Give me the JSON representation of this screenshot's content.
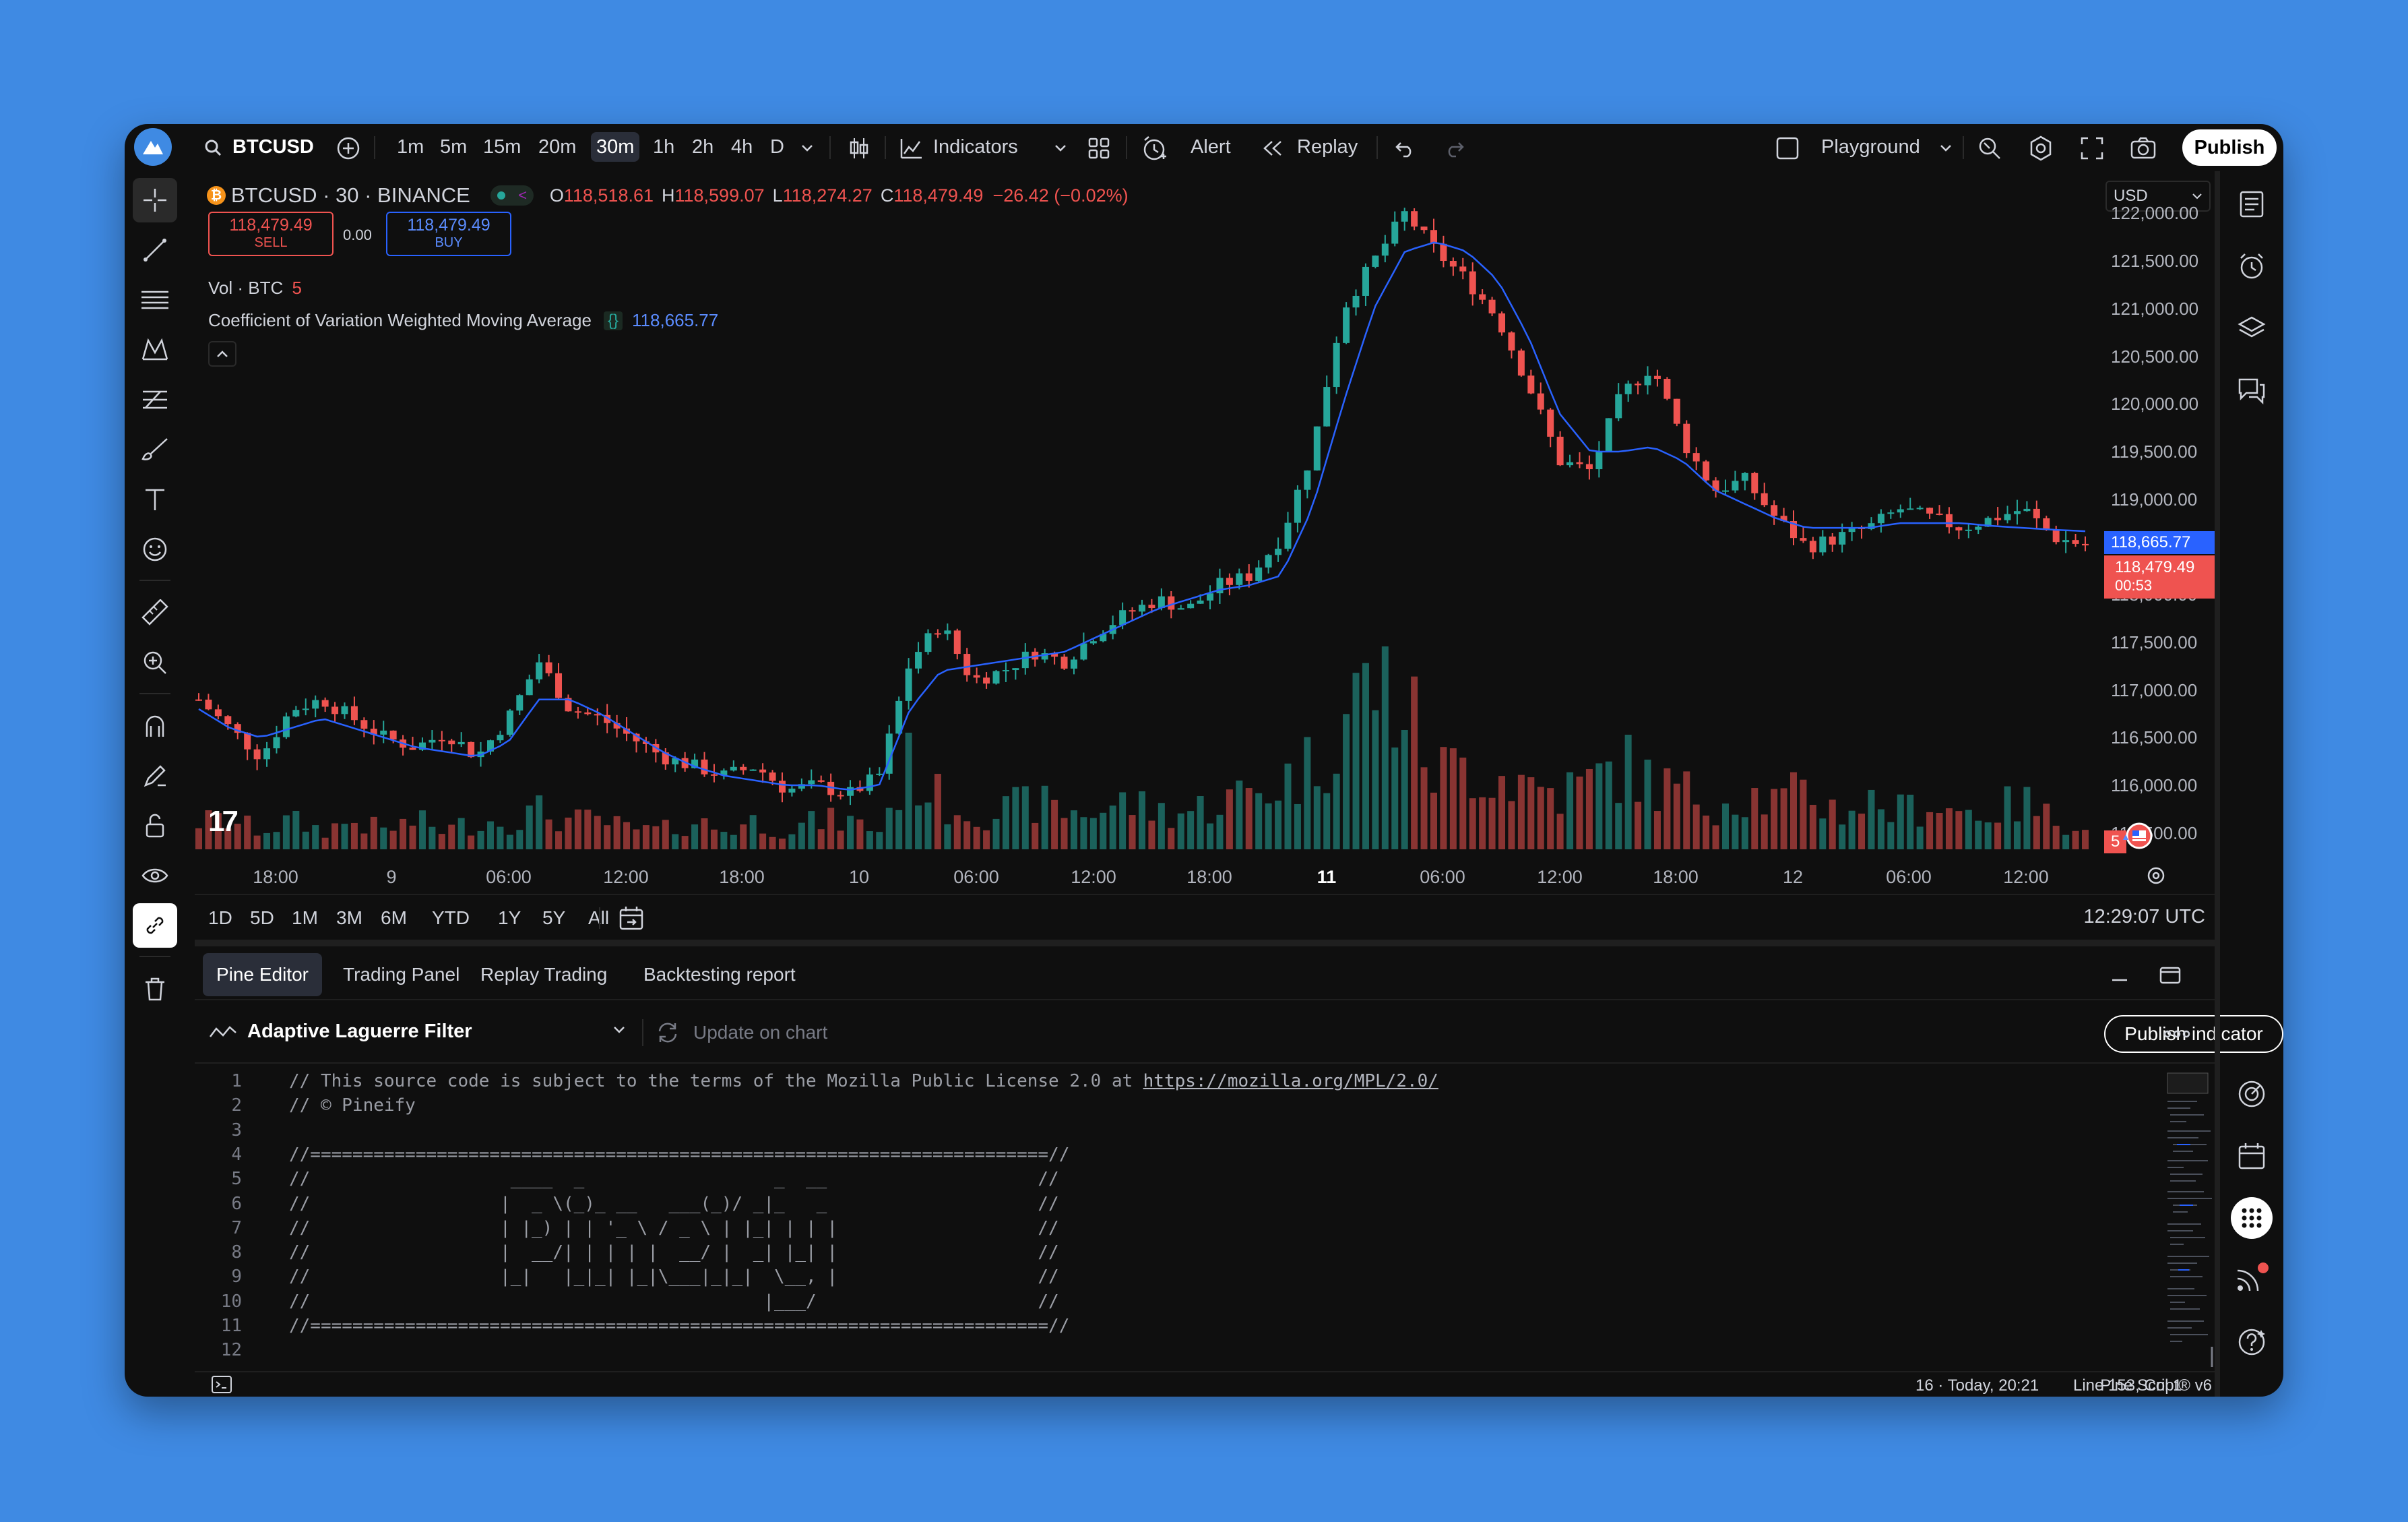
{
  "colors": {
    "up": "#26a69a",
    "down": "#ef5350",
    "ma": "#2962ff",
    "bg": "#0f0f0f",
    "accent": "#3f8ae3"
  },
  "topbar": {
    "symbol": "BTCUSD",
    "intervals": [
      "1m",
      "5m",
      "15m",
      "20m",
      "30m",
      "1h",
      "2h",
      "4h",
      "D"
    ],
    "active_interval": "30m",
    "indicators_label": "Indicators",
    "alert_label": "Alert",
    "replay_label": "Replay",
    "layout_label": "Playground",
    "publish_label": "Publish"
  },
  "chart": {
    "symbol_line": "BTCUSD · 30 · BINANCE",
    "ohlc": {
      "o_label": "O",
      "o": "118,518.61",
      "h_label": "H",
      "h": "118,599.07",
      "l_label": "L",
      "l": "118,274.27",
      "c_label": "C",
      "c": "118,479.49",
      "change": "−26.42 (−0.02%)"
    },
    "sell_price": "118,479.49",
    "sell_label": "SELL",
    "spread": "0.00",
    "buy_price": "118,479.49",
    "buy_label": "BUY",
    "vol_label": "Vol · BTC",
    "vol_value": "5",
    "indicator_name": "Coefficient of Variation Weighted Moving Average",
    "indicator_code_icon": "{}",
    "indicator_value": "118,665.77",
    "currency": "USD",
    "price_scale": [
      "122,000.00",
      "121,500.00",
      "121,000.00",
      "120,500.00",
      "120,000.00",
      "119,500.00",
      "119,000.00",
      "118,000.00",
      "117,500.00",
      "117,000.00",
      "116,500.00",
      "116,000.00",
      "115,500.00"
    ],
    "ma_tag": "118,665.77",
    "last_price_tag": "118,479.49",
    "countdown": "00:53",
    "vol_tag": "5",
    "time_labels": [
      "18:00",
      "9",
      "06:00",
      "12:00",
      "18:00",
      "10",
      "06:00",
      "12:00",
      "18:00",
      "11",
      "06:00",
      "12:00",
      "18:00",
      "12",
      "06:00",
      "12:00"
    ],
    "time_bold": "11",
    "ranges": [
      "1D",
      "5D",
      "1M",
      "3M",
      "6M",
      "YTD",
      "1Y",
      "5Y",
      "All"
    ],
    "clock": "12:29:07 UTC",
    "logo_text": "17"
  },
  "chart_data": {
    "type": "candlestick",
    "xlabel": "",
    "ylabel": "",
    "ylim": [
      115300,
      122300
    ],
    "x_ticks": [
      "18:00",
      "9",
      "06:00",
      "12:00",
      "18:00",
      "10",
      "06:00",
      "12:00",
      "18:00",
      "11",
      "06:00",
      "12:00",
      "18:00",
      "12",
      "06:00",
      "12:00"
    ],
    "y_ticks": [
      115500,
      116000,
      116500,
      117000,
      117500,
      118000,
      118500,
      119000,
      119500,
      120000,
      120500,
      121000,
      121500,
      122000
    ],
    "close_anchors": [
      116900,
      116600,
      116300,
      116800,
      116900,
      116700,
      116500,
      116400,
      116550,
      116300,
      116700,
      117300,
      116800,
      116700,
      116500,
      116300,
      116200,
      116100,
      116200,
      115950,
      116000,
      115900,
      116100,
      117300,
      117700,
      117100,
      117200,
      117400,
      117300,
      117600,
      117800,
      117950,
      117850,
      118100,
      118200,
      118600,
      119500,
      121000,
      121500,
      122000,
      121600,
      121300,
      120900,
      120200,
      119400,
      119300,
      120100,
      120400,
      119600,
      119100,
      119200,
      118800,
      118500,
      118600,
      118700,
      118900,
      118800,
      118700,
      118800,
      118900,
      118600,
      118520
    ],
    "ma_anchors": [
      116800,
      116600,
      116500,
      116600,
      116700,
      116600,
      116500,
      116400,
      116350,
      116300,
      116450,
      116900,
      116900,
      116750,
      116550,
      116350,
      116200,
      116100,
      116050,
      116000,
      116000,
      115950,
      116000,
      116800,
      117200,
      117250,
      117300,
      117350,
      117400,
      117550,
      117700,
      117850,
      117950,
      118050,
      118100,
      118200,
      118900,
      120000,
      121000,
      121600,
      121700,
      121600,
      121300,
      120700,
      119900,
      119500,
      119500,
      119550,
      119400,
      119100,
      118950,
      118800,
      118700,
      118700,
      118700,
      118750,
      118750,
      118750,
      118720,
      118700,
      118680,
      118665
    ],
    "volume_anchors": [
      3,
      3,
      2,
      3,
      2,
      3,
      2,
      3,
      2,
      3,
      3,
      4,
      3,
      3,
      2,
      2,
      3,
      2,
      3,
      2,
      3,
      3,
      2,
      9,
      5,
      4,
      4,
      5,
      4,
      4,
      5,
      4,
      4,
      5,
      6,
      7,
      9,
      14,
      18,
      15,
      8,
      9,
      8,
      7,
      6,
      7,
      9,
      7,
      6,
      5,
      6,
      5,
      6,
      4,
      5,
      4,
      5,
      4,
      4,
      5,
      3,
      3
    ]
  },
  "bottom": {
    "tabs": [
      "Pine Editor",
      "Trading Panel",
      "Replay Trading",
      "Backtesting report"
    ],
    "active_tab": "Pine Editor",
    "script_name": "Adaptive Laguerre Filter",
    "update_label": "Update on chart",
    "publish_indicator": "Publish indicator",
    "code_lines": [
      "// This source code is subject to the terms of the Mozilla Public License 2.0 at ",
      "// © Pineify",
      "",
      "//======================================================================//",
      "//                   ____  _                  _  __                    //",
      "//                  |  _ \\(_)_ __   ___(_)/ _|_   _                    //",
      "//                  | |_) | | '_ \\ / _ \\ | |_| | | |                   //",
      "//                  |  __/| | | | |  __/ |  _| |_| |                   //",
      "//                  |_|   |_|_| |_|\\___|_|_|  \\__, |                   //",
      "//                                           |___/                     //",
      "//======================================================================//",
      ""
    ],
    "license_url": "https://mozilla.org/MPL/2.0/",
    "status": "16 · Today, 20:21",
    "cursor": "Line 153, Col 1",
    "language": "Pine Script® v6"
  }
}
